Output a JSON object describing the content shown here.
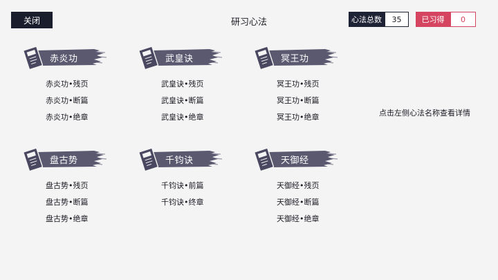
{
  "header": {
    "close_label": "关闭",
    "title": "研习心法",
    "total_label": "心法总数",
    "total_value": "35",
    "learned_label": "已习得",
    "learned_value": "0"
  },
  "groups": [
    {
      "name": "赤炎功",
      "items": [
        "赤炎功•残页",
        "赤炎功•断篇",
        "赤炎功•绝章"
      ]
    },
    {
      "name": "武皇诀",
      "items": [
        "武皇诀•残页",
        "武皇诀•断篇",
        "武皇诀•绝章"
      ]
    },
    {
      "name": "冥王功",
      "items": [
        "冥王功•残页",
        "冥王功•断篇",
        "冥王功•绝章"
      ]
    },
    {
      "name": "盘古势",
      "items": [
        "盘古势•残页",
        "盘古势•断篇",
        "盘古势•绝章"
      ]
    },
    {
      "name": "千钧诀",
      "items": [
        "千钧诀•前篇",
        "千钧诀•终章"
      ]
    },
    {
      "name": "天御经",
      "items": [
        "天御经•残页",
        "天御经•断篇",
        "天御经•绝章"
      ]
    }
  ],
  "hint": "点击左侧心法名称查看详情",
  "colors": {
    "dark": "#1e2235",
    "accent": "#d5455f",
    "brush": "#5b5970",
    "background": "#f5f4f5"
  },
  "icons": {
    "group_icon": "scroll-book-icon"
  }
}
